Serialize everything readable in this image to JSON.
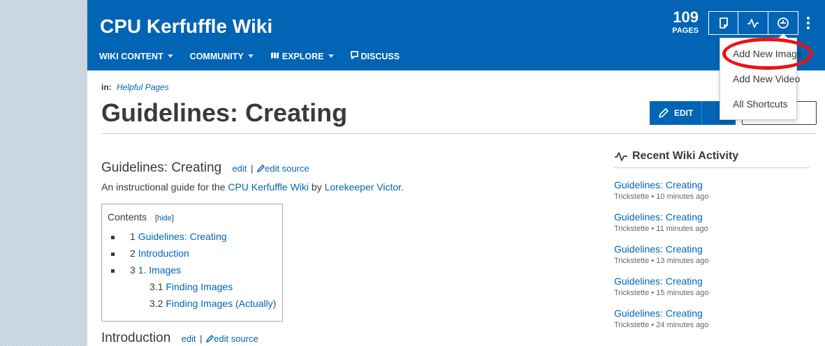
{
  "header": {
    "wiki_title": "CPU Kerfuffle Wiki",
    "pages_count": "109",
    "pages_label": "PAGES",
    "nav": [
      {
        "label": "WIKI CONTENT",
        "has_caret": true
      },
      {
        "label": "COMMUNITY",
        "has_caret": true
      },
      {
        "label": "EXPLORE",
        "has_caret": true,
        "icon": "explore-icon"
      },
      {
        "label": "DISCUSS",
        "has_caret": false,
        "icon": "discuss-icon"
      }
    ],
    "tools": [
      "add-page-icon",
      "recent-activity-icon",
      "wiki-discovery-icon",
      "more-options-icon"
    ],
    "accent": "#0164b4"
  },
  "dropdown": {
    "items": [
      "Add New Image",
      "Add New Video",
      "All Shortcuts"
    ],
    "annotation_color": "#ee1111"
  },
  "article": {
    "breadcrumb_label": "in:",
    "breadcrumb_link": "Helpful Pages",
    "title": "Guidelines: Creating",
    "edit_label": "EDIT",
    "sections": [
      {
        "heading": "Guidelines: Creating",
        "edit": "edit",
        "sep": "|",
        "edit_source": "edit source"
      },
      {
        "heading": "Introduction",
        "edit": "edit",
        "sep": "|",
        "edit_source": "edit source"
      }
    ],
    "intro": {
      "prefix": "An instructional guide for the ",
      "link1": "CPU Kerfuffle Wiki",
      "middle": " by ",
      "link2": "Lorekeeper Victor",
      "suffix": "."
    },
    "toc": {
      "title": "Contents",
      "hide_open": "[",
      "hide": "hide",
      "hide_close": "]",
      "items": [
        {
          "num": "1",
          "label": "Guidelines: Creating"
        },
        {
          "num": "2",
          "label": "Introduction"
        },
        {
          "num": "3",
          "label": "1. Images"
        },
        {
          "num": "3.1",
          "label": "Finding Images"
        },
        {
          "num": "3.2",
          "label": "Finding Images (Actually)"
        }
      ]
    }
  },
  "rail": {
    "heading": "Recent Wiki Activity",
    "activities": [
      {
        "title": "Guidelines: Creating",
        "meta": "Trickstette • 10 minutes ago"
      },
      {
        "title": "Guidelines: Creating",
        "meta": "Trickstette • 11 minutes ago"
      },
      {
        "title": "Guidelines: Creating",
        "meta": "Trickstette • 13 minutes ago"
      },
      {
        "title": "Guidelines: Creating",
        "meta": "Trickstette • 15 minutes ago"
      },
      {
        "title": "Guidelines: Creating",
        "meta": "Trickstette • 24 minutes ago"
      }
    ]
  }
}
